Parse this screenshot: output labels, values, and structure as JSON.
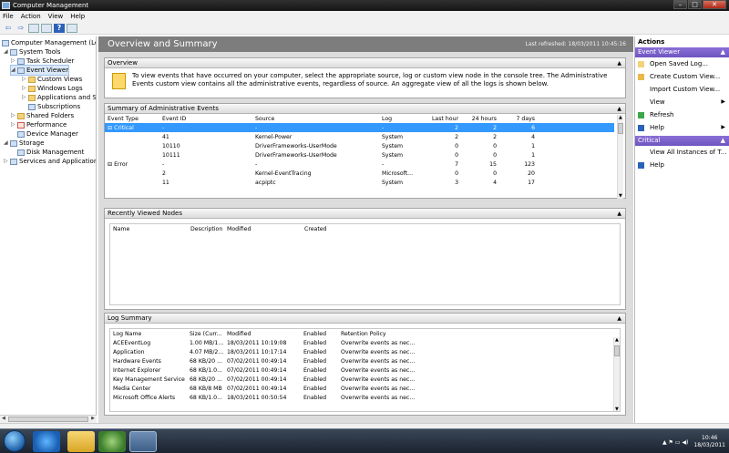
{
  "window": {
    "title": "Computer Management"
  },
  "menu": [
    "File",
    "Action",
    "View",
    "Help"
  ],
  "toolbar": {
    "back": "⇦",
    "forward": "⇨",
    "help": "?"
  },
  "tree": {
    "root": "Computer Management (Local",
    "system_tools": "System Tools",
    "task_scheduler": "Task Scheduler",
    "event_viewer": "Event Viewer",
    "custom_views": "Custom Views",
    "windows_logs": "Windows Logs",
    "apps_services": "Applications and Se",
    "subscriptions": "Subscriptions",
    "shared_folders": "Shared Folders",
    "performance": "Performance",
    "device_manager": "Device Manager",
    "storage": "Storage",
    "disk_management": "Disk Management",
    "services_apps": "Services and Applications"
  },
  "main": {
    "title": "Overview and Summary",
    "last_refreshed": "Last refreshed: 18/03/2011 10:45:16",
    "overview": {
      "header": "Overview",
      "text": "To view events that have occurred on your computer, select the appropriate source, log or custom view node in the console tree. The Administrative Events custom view contains all the administrative events, regardless of source. An aggregate view of all the logs is shown below."
    },
    "summary": {
      "header": "Summary of Administrative Events",
      "columns": [
        "Event Type",
        "Event ID",
        "Source",
        "Log",
        "Last hour",
        "24 hours",
        "7 days"
      ],
      "rows": [
        [
          "⊟ Critical",
          "-",
          "-",
          "-",
          "2",
          "2",
          "6"
        ],
        [
          "",
          "41",
          "Kernel-Power",
          "System",
          "2",
          "2",
          "4"
        ],
        [
          "",
          "10110",
          "DriverFrameworks-UserMode",
          "System",
          "0",
          "0",
          "1"
        ],
        [
          "",
          "10111",
          "DriverFrameworks-UserMode",
          "System",
          "0",
          "0",
          "1"
        ],
        [
          "⊟ Error",
          "-",
          "-",
          "-",
          "7",
          "15",
          "123"
        ],
        [
          "",
          "2",
          "Kernel-EventTracing",
          "Microsoft...",
          "0",
          "0",
          "20"
        ],
        [
          "",
          "11",
          "acpiptc",
          "System",
          "3",
          "4",
          "17"
        ]
      ]
    },
    "recent": {
      "header": "Recently Viewed Nodes",
      "columns": [
        "Name",
        "Description",
        "Modified",
        "Created"
      ]
    },
    "log_summary": {
      "header": "Log Summary",
      "columns": [
        "Log Name",
        "Size (Curr...",
        "Modified",
        "Enabled",
        "Retention Policy"
      ],
      "rows": [
        [
          "ACEEventLog",
          "1.00 MB/1...",
          "18/03/2011 10:19:08",
          "Enabled",
          "Overwrite events as nec..."
        ],
        [
          "Application",
          "4.07 MB/2...",
          "18/03/2011 10:17:14",
          "Enabled",
          "Overwrite events as nec..."
        ],
        [
          "Hardware Events",
          "68 KB/20 ...",
          "07/02/2011 00:49:14",
          "Enabled",
          "Overwrite events as nec..."
        ],
        [
          "Internet Explorer",
          "68 KB/1.0...",
          "07/02/2011 00:49:14",
          "Enabled",
          "Overwrite events as nec..."
        ],
        [
          "Key Management Service",
          "68 KB/20 ...",
          "07/02/2011 00:49:14",
          "Enabled",
          "Overwrite events as nec..."
        ],
        [
          "Media Center",
          "68 KB/8 MB",
          "07/02/2011 00:49:14",
          "Enabled",
          "Overwrite events as nec..."
        ],
        [
          "Microsoft Office Alerts",
          "68 KB/1.0...",
          "18/03/2011 00:50:54",
          "Enabled",
          "Overwrite events as nec..."
        ]
      ]
    }
  },
  "actions": {
    "header": "Actions",
    "event_viewer": "Event Viewer",
    "items": [
      "Open Saved Log...",
      "Create Custom View...",
      "Import Custom View...",
      "View",
      "Refresh",
      "Help"
    ],
    "critical": "Critical",
    "critical_items": [
      "View All Instances of T...",
      "Help"
    ]
  },
  "taskbar": {
    "time": "10:46",
    "date": "18/03/2011"
  }
}
